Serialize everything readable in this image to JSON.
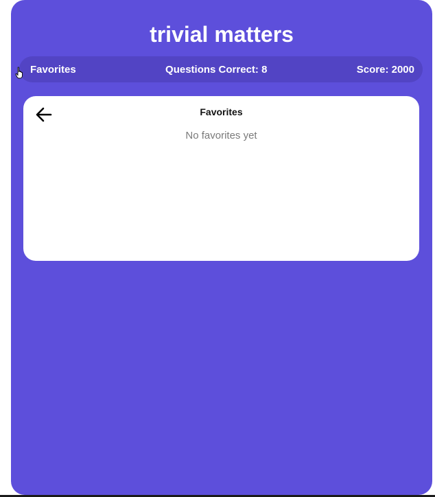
{
  "app": {
    "title": "trivial matters",
    "background_color": "#5d4fdb"
  },
  "stats_bar": {
    "favorites_label": "Favorites",
    "questions_correct": "Questions Correct: 8",
    "score": "Score: 2000"
  },
  "favorites_panel": {
    "back_icon": "arrow-left-icon",
    "title": "Favorites",
    "empty_message": "No favorites yet"
  },
  "cursor_icon": "hand-pointer-icon"
}
